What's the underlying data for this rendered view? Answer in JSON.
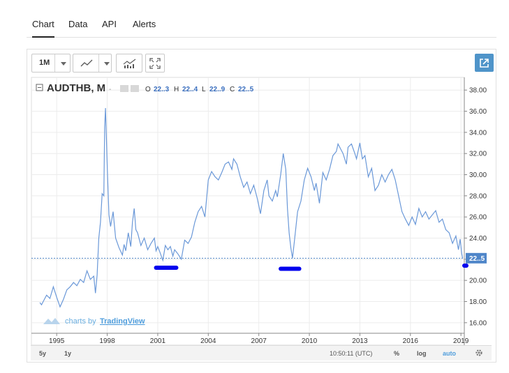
{
  "tabs": [
    {
      "label": "Chart",
      "active": true
    },
    {
      "label": "Data",
      "active": false
    },
    {
      "label": "API",
      "active": false
    },
    {
      "label": "Alerts",
      "active": false
    }
  ],
  "toolbar": {
    "interval_label": "1M",
    "style_icon": "line-chart-icon",
    "indicators_icon": "indicators-icon",
    "fullscreen_icon": "fullscreen-icon",
    "popout_icon": "popout-icon"
  },
  "legend": {
    "symbol": "AUDTHB, M",
    "o_key": "O",
    "o_val": "22..3",
    "h_key": "H",
    "h_val": "22..4",
    "l_key": "L",
    "l_val": "22..9",
    "c_key": "C",
    "c_val": "22..5"
  },
  "watermark": {
    "prefix": "charts by",
    "brand": "TradingView"
  },
  "bottom_bar": {
    "range_5y": "5y",
    "range_1y": "1y",
    "time": "10:50:11 (UTC)",
    "percent": "%",
    "log": "log",
    "auto": "auto"
  },
  "colors": {
    "line": "#6a98d8",
    "price_tag": "#4f86c9",
    "marker": "#0000ee",
    "accent": "#4f94c9"
  },
  "chart_data": {
    "type": "line",
    "x_range": [
      1993.5,
      2019.2
    ],
    "ylim": [
      15.0,
      39.2
    ],
    "y_ticks": [
      "16.00",
      "18.00",
      "20.00",
      "22.00",
      "24.00",
      "26.00",
      "28.00",
      "30.00",
      "32.00",
      "34.00",
      "36.00",
      "38.00"
    ],
    "x_ticks": [
      "1995",
      "1998",
      "2001",
      "2004",
      "2007",
      "2010",
      "2013",
      "2016",
      "2019"
    ],
    "last_price_label": "22..5",
    "last_price": 22.1,
    "grid": true,
    "series": [
      {
        "points": [
          [
            1994.0,
            17.9
          ],
          [
            1994.1,
            17.7
          ],
          [
            1994.2,
            18.0
          ],
          [
            1994.4,
            18.6
          ],
          [
            1994.6,
            18.3
          ],
          [
            1994.8,
            19.4
          ],
          [
            1995.0,
            18.4
          ],
          [
            1995.2,
            17.5
          ],
          [
            1995.4,
            18.2
          ],
          [
            1995.6,
            19.1
          ],
          [
            1995.8,
            19.4
          ],
          [
            1996.0,
            19.8
          ],
          [
            1996.2,
            19.5
          ],
          [
            1996.4,
            20.1
          ],
          [
            1996.6,
            19.8
          ],
          [
            1996.8,
            20.9
          ],
          [
            1997.0,
            20.1
          ],
          [
            1997.2,
            20.4
          ],
          [
            1997.3,
            18.8
          ],
          [
            1997.4,
            20.5
          ],
          [
            1997.5,
            24.0
          ],
          [
            1997.6,
            25.5
          ],
          [
            1997.7,
            28.2
          ],
          [
            1997.8,
            28.0
          ],
          [
            1997.85,
            34.5
          ],
          [
            1997.9,
            36.3
          ],
          [
            1998.0,
            30.8
          ],
          [
            1998.1,
            26.2
          ],
          [
            1998.2,
            25.1
          ],
          [
            1998.35,
            26.5
          ],
          [
            1998.5,
            24.0
          ],
          [
            1998.7,
            23.1
          ],
          [
            1998.9,
            22.4
          ],
          [
            1999.0,
            23.4
          ],
          [
            1999.1,
            22.8
          ],
          [
            1999.25,
            24.5
          ],
          [
            1999.4,
            23.2
          ],
          [
            1999.5,
            25.5
          ],
          [
            1999.6,
            26.8
          ],
          [
            1999.7,
            24.8
          ],
          [
            1999.8,
            24.5
          ],
          [
            2000.0,
            23.3
          ],
          [
            2000.2,
            24.0
          ],
          [
            2000.4,
            22.9
          ],
          [
            2000.6,
            23.5
          ],
          [
            2000.8,
            24.0
          ],
          [
            2000.9,
            22.8
          ],
          [
            2001.0,
            23.2
          ],
          [
            2001.1,
            22.8
          ],
          [
            2001.3,
            21.9
          ],
          [
            2001.45,
            23.3
          ],
          [
            2001.6,
            22.9
          ],
          [
            2001.75,
            23.2
          ],
          [
            2001.9,
            22.3
          ],
          [
            2002.0,
            22.9
          ],
          [
            2002.2,
            22.5
          ],
          [
            2002.4,
            22.0
          ],
          [
            2002.6,
            23.8
          ],
          [
            2002.8,
            23.5
          ],
          [
            2003.0,
            24.1
          ],
          [
            2003.2,
            25.5
          ],
          [
            2003.4,
            26.5
          ],
          [
            2003.6,
            27.0
          ],
          [
            2003.8,
            26.0
          ],
          [
            2004.0,
            29.5
          ],
          [
            2004.2,
            30.3
          ],
          [
            2004.4,
            29.8
          ],
          [
            2004.6,
            29.5
          ],
          [
            2004.8,
            30.2
          ],
          [
            2005.0,
            31.0
          ],
          [
            2005.2,
            31.2
          ],
          [
            2005.4,
            30.5
          ],
          [
            2005.5,
            31.5
          ],
          [
            2005.7,
            31.0
          ],
          [
            2005.9,
            29.8
          ],
          [
            2006.1,
            28.8
          ],
          [
            2006.3,
            29.3
          ],
          [
            2006.5,
            28.2
          ],
          [
            2006.7,
            29.0
          ],
          [
            2006.9,
            27.8
          ],
          [
            2007.1,
            26.3
          ],
          [
            2007.3,
            28.5
          ],
          [
            2007.5,
            29.5
          ],
          [
            2007.6,
            28.0
          ],
          [
            2007.8,
            27.5
          ],
          [
            2008.0,
            28.5
          ],
          [
            2008.1,
            27.9
          ],
          [
            2008.3,
            30.0
          ],
          [
            2008.45,
            32.0
          ],
          [
            2008.6,
            30.5
          ],
          [
            2008.7,
            26.8
          ],
          [
            2008.8,
            24.5
          ],
          [
            2008.9,
            23.1
          ],
          [
            2009.0,
            22.1
          ],
          [
            2009.1,
            23.5
          ],
          [
            2009.3,
            26.5
          ],
          [
            2009.5,
            27.5
          ],
          [
            2009.7,
            29.5
          ],
          [
            2009.9,
            30.6
          ],
          [
            2010.1,
            29.8
          ],
          [
            2010.3,
            28.5
          ],
          [
            2010.4,
            29.2
          ],
          [
            2010.6,
            27.3
          ],
          [
            2010.8,
            30.2
          ],
          [
            2011.0,
            29.5
          ],
          [
            2011.2,
            30.5
          ],
          [
            2011.4,
            31.8
          ],
          [
            2011.6,
            32.2
          ],
          [
            2011.7,
            32.9
          ],
          [
            2011.9,
            32.3
          ],
          [
            2012.0,
            32.0
          ],
          [
            2012.2,
            31.0
          ],
          [
            2012.3,
            32.6
          ],
          [
            2012.5,
            32.9
          ],
          [
            2012.7,
            32.0
          ],
          [
            2012.8,
            31.5
          ],
          [
            2013.0,
            33.0
          ],
          [
            2013.15,
            31.5
          ],
          [
            2013.3,
            31.8
          ],
          [
            2013.5,
            29.8
          ],
          [
            2013.7,
            30.6
          ],
          [
            2013.9,
            28.5
          ],
          [
            2014.1,
            29.0
          ],
          [
            2014.3,
            30.0
          ],
          [
            2014.5,
            29.3
          ],
          [
            2014.7,
            30.0
          ],
          [
            2014.9,
            30.5
          ],
          [
            2015.1,
            29.5
          ],
          [
            2015.3,
            28.0
          ],
          [
            2015.5,
            26.5
          ],
          [
            2015.7,
            25.8
          ],
          [
            2015.9,
            25.2
          ],
          [
            2016.1,
            26.0
          ],
          [
            2016.3,
            25.3
          ],
          [
            2016.5,
            26.8
          ],
          [
            2016.7,
            26.0
          ],
          [
            2016.9,
            26.5
          ],
          [
            2017.1,
            25.8
          ],
          [
            2017.3,
            26.2
          ],
          [
            2017.5,
            26.6
          ],
          [
            2017.7,
            25.5
          ],
          [
            2017.9,
            25.8
          ],
          [
            2018.1,
            24.8
          ],
          [
            2018.3,
            24.5
          ],
          [
            2018.5,
            23.5
          ],
          [
            2018.7,
            24.2
          ],
          [
            2018.85,
            22.9
          ],
          [
            2018.95,
            23.9
          ],
          [
            2019.05,
            22.5
          ],
          [
            2019.1,
            22.1
          ]
        ]
      }
    ],
    "annotations": [
      {
        "type": "marker",
        "x": [
          2000.9,
          2002.1
        ],
        "y": 21.2
      },
      {
        "type": "marker",
        "x": [
          2008.3,
          2009.4
        ],
        "y": 21.1
      },
      {
        "type": "marker",
        "x": [
          2019.2,
          2019.7
        ],
        "y": 21.4
      }
    ]
  }
}
